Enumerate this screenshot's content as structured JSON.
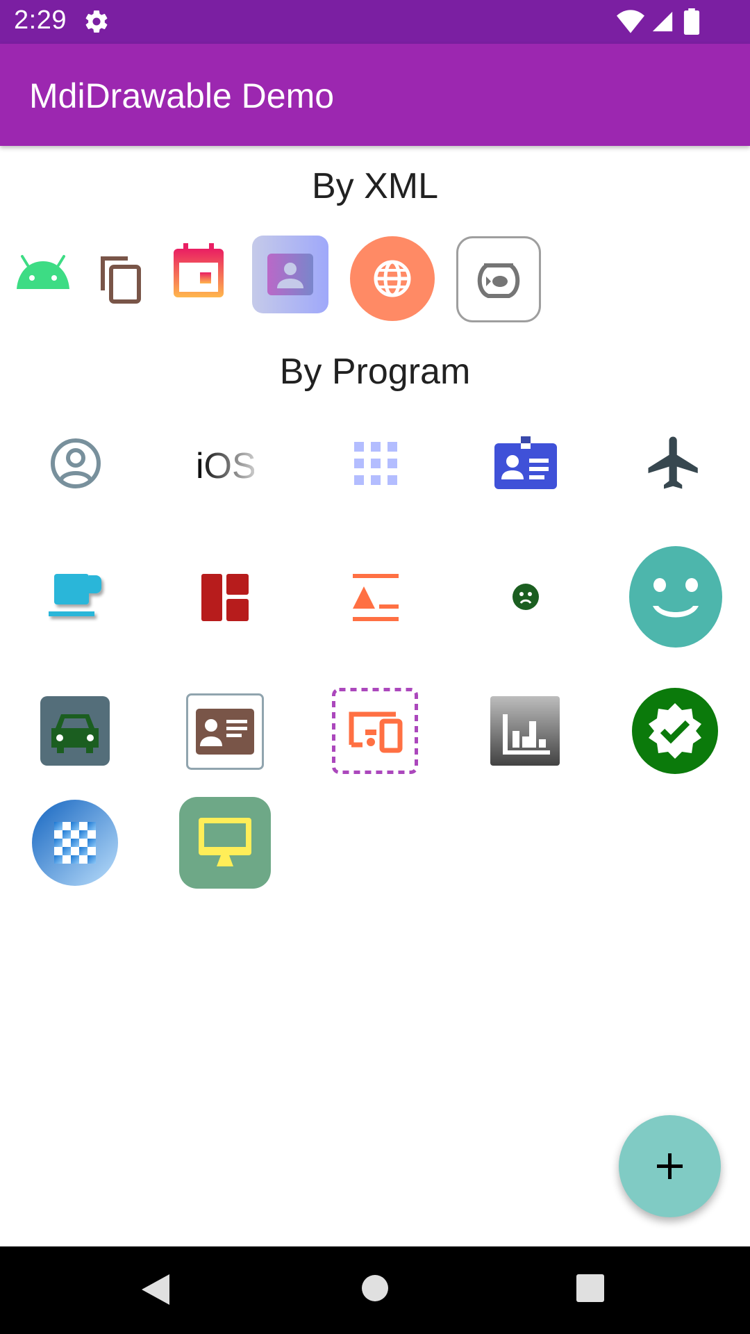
{
  "status_bar": {
    "time": "2:29",
    "icons": [
      "gear-icon",
      "wifi-icon",
      "signal-icon",
      "battery-icon"
    ]
  },
  "app_bar": {
    "title": "MdiDrawable Demo",
    "color": "#9c27b0"
  },
  "sections": {
    "xml_title": "By XML",
    "program_title": "By Program"
  },
  "xml_icons": [
    "android-icon",
    "content-copy-icon",
    "calendar-icon",
    "contact-icon",
    "web-icon",
    "fishbowl-icon"
  ],
  "program_icons": [
    "account-circle-icon",
    "apple-ios-icon",
    "apps-icon",
    "card-account-details-icon",
    "airplane-icon",
    "coffee-icon",
    "view-dashboard-icon",
    "format-align-icon",
    "emoticon-sad-icon",
    "emoticon-happy-icon",
    "car-icon",
    "account-box-icon",
    "devices-icon",
    "chart-bar-icon",
    "check-decagram-icon",
    "checkerboard-icon",
    "monitor-icon"
  ],
  "fab": {
    "label": "+",
    "color": "#80cbc4"
  },
  "nav_bar": [
    "back-button",
    "home-button",
    "recents-button"
  ]
}
